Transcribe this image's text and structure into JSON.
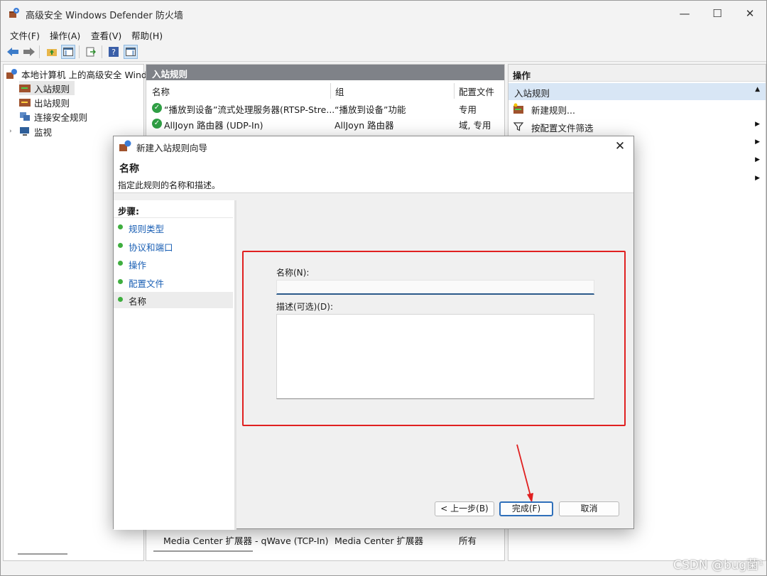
{
  "window": {
    "title": "高级安全 Windows Defender 防火墙",
    "minimize": "—",
    "maximize": "☐",
    "close": "✕"
  },
  "menu": [
    "文件(F)",
    "操作(A)",
    "查看(V)",
    "帮助(H)"
  ],
  "tree": {
    "root": "本地计算机 上的高级安全 Wind",
    "items": [
      "入站规则",
      "出站规则",
      "连接安全规则",
      "监视"
    ]
  },
  "center": {
    "header": "入站规则",
    "columns": [
      "名称",
      "组",
      "配置文件"
    ],
    "rows": [
      {
        "name": "“播放到设备”流式处理服务器(RTSP-Stre...",
        "group": "“播放到设备”功能",
        "profile": "专用"
      },
      {
        "name": "AllJoyn 路由器 (UDP-In)",
        "group": "AllJoyn 路由器",
        "profile": "域, 专用"
      }
    ],
    "bottom_row": {
      "name": "Media Center 扩展器 - qWave (TCP-In)",
      "group": "Media Center 扩展器",
      "profile": "所有"
    }
  },
  "actions": {
    "header": "操作",
    "subheader": "入站规则",
    "items": [
      "新建规则...",
      "按配置文件筛选"
    ]
  },
  "dialog": {
    "title": "新建入站规则向导",
    "heading": "名称",
    "subheading": "指定此规则的名称和描述。",
    "steps_label": "步骤:",
    "steps": [
      "规则类型",
      "协议和端口",
      "操作",
      "配置文件",
      "名称"
    ],
    "name_label": "名称(N):",
    "name_value": "",
    "desc_label": "描述(可选)(D):",
    "desc_value": "",
    "buttons": {
      "back": "< 上一步(B)",
      "finish": "完成(F)",
      "cancel": "取消"
    }
  },
  "watermark": "CSDN @bug菌¹"
}
